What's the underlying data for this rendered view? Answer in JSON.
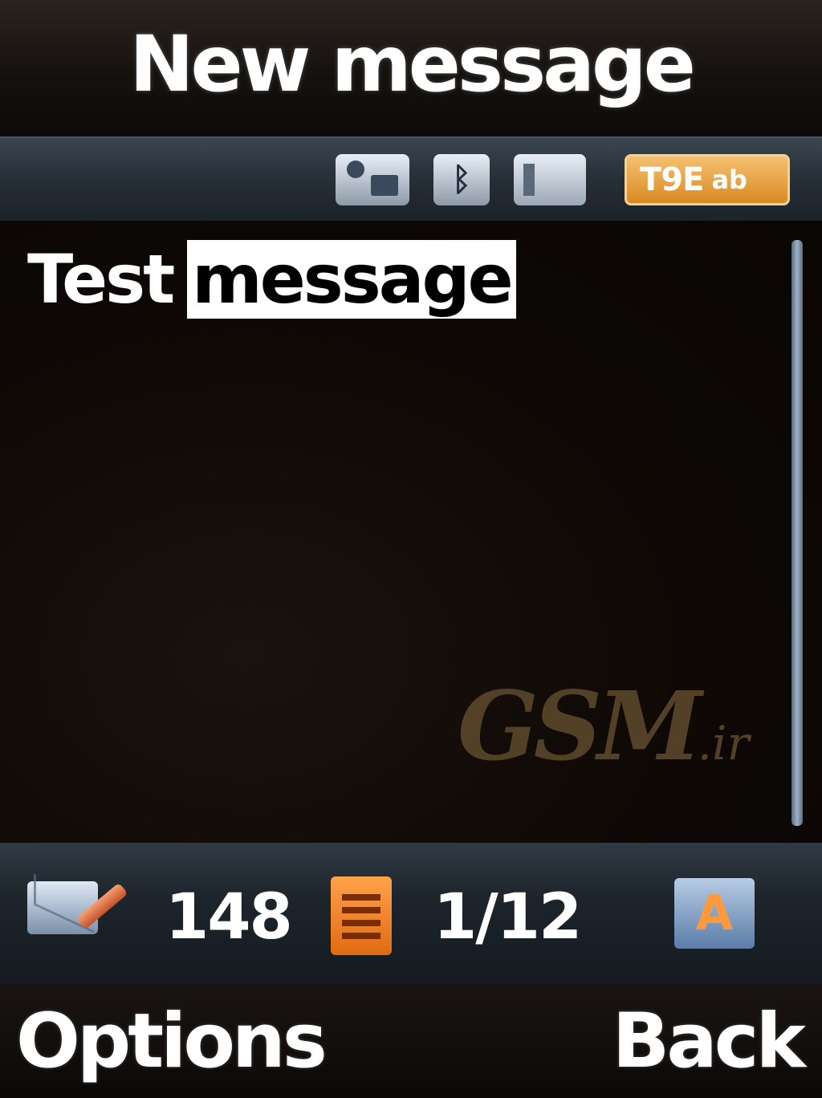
{
  "header": {
    "title": "New message"
  },
  "status_icons": {
    "pairing": "contact-pair-icon",
    "bluetooth": "bluetooth-icon",
    "memory": "memory-card-icon",
    "input_mode": {
      "icon": "t9-input-mode-icon",
      "label": "T9E",
      "sub_label": "ab",
      "color": "#e49a35"
    }
  },
  "editor": {
    "text_plain": "Test",
    "text_selected": "message"
  },
  "watermark": {
    "main": "GSM",
    "suffix": ".ir"
  },
  "info_bar": {
    "chars_remaining": "148",
    "page_counter": "1/12",
    "compose_icon": "compose-mail-icon",
    "page_icon": "page-icon",
    "mode_icon": "input-case-icon",
    "mode_glyph": "A"
  },
  "softkeys": {
    "left": "Options",
    "right": "Back"
  }
}
